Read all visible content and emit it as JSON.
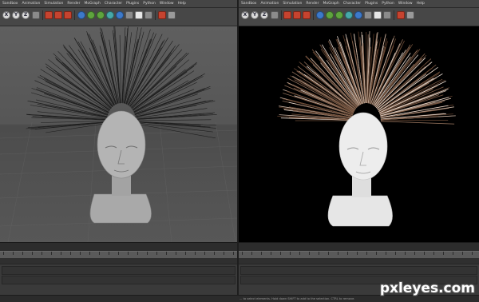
{
  "menu": [
    "Sandbox",
    "Animation",
    "Simulation",
    "Render",
    "MoGraph",
    "Character",
    "Plugins",
    "Python",
    "Window",
    "Help"
  ],
  "status_text": "... to select elements. Hold down SHIFT to add to the selection. CTRL to remove.",
  "watermark": "pxleyes.com",
  "toolbar_icons": [
    "axis-x-icon",
    "axis-y-icon",
    "axis-z-icon",
    "world-icon",
    "clapper-icon",
    "render-icon",
    "render-settings-icon",
    "cube-icon",
    "pen-icon",
    "subdivision-icon",
    "array-icon",
    "deformer-icon",
    "scene-icon",
    "camera-icon",
    "light-icon",
    "lock-icon"
  ],
  "colors": {
    "ui_bg": "#3a3a3a",
    "toolbar": "#474747",
    "viewport_left": "#585858",
    "viewport_right": "#000000",
    "accent_red": "#c6432f"
  }
}
